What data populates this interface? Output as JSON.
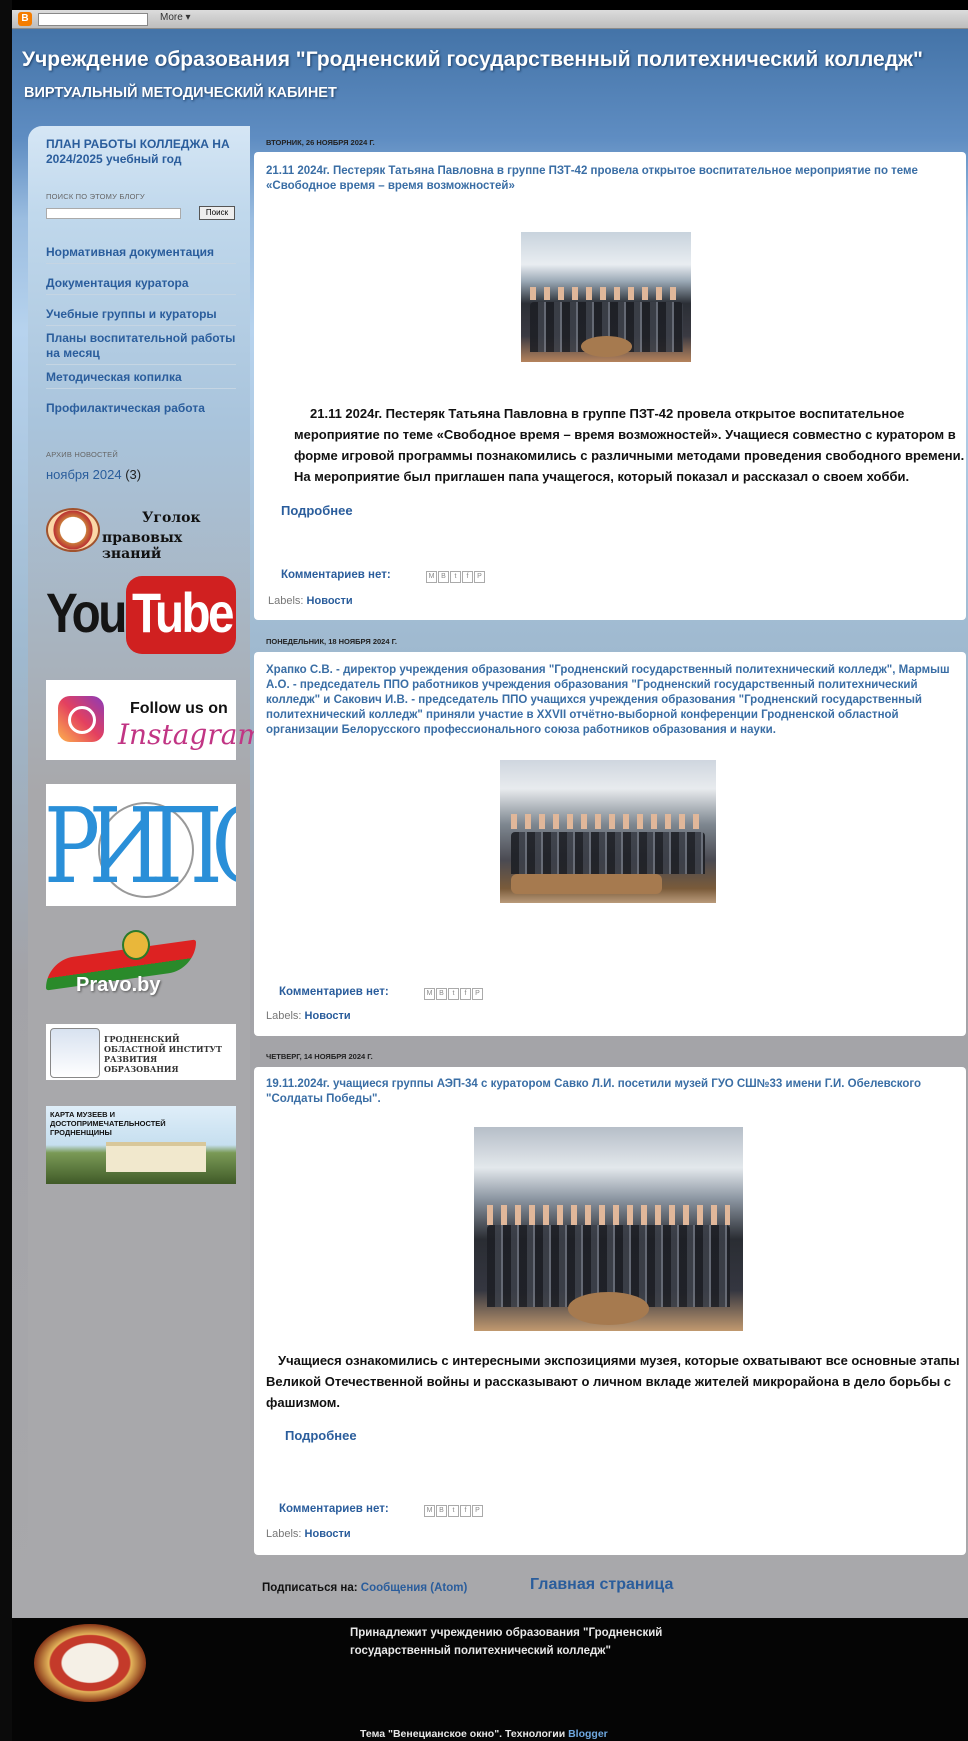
{
  "navbar": {
    "more_label": "More ▾",
    "logo": "B"
  },
  "header": {
    "title": "Учреждение образования \"Гродненский государственный политехнический колледж\"",
    "subtitle": "ВИРТУАЛЬНЫЙ МЕТОДИЧЕСКИЙ КАБИНЕТ"
  },
  "sidebar": {
    "plan_link": "ПЛАН РАБОТЫ КОЛЛЕДЖА НА 2024/2025 учебный год",
    "search_label": "ПОИСК ПО ЭТОМУ БЛОГУ",
    "search_button": "Поиск",
    "links": [
      "Нормативная документация",
      "Документация куратора",
      "Учебные группы и кураторы",
      "Планы воспитательной работы на месяц",
      "Методическая копилка",
      "Профилактическая работа"
    ],
    "archive_label": "АРХИВ НОВОСТЕЙ",
    "archive_month": "ноября 2024",
    "archive_count": "(3)",
    "ugolok_line1": "Уголок",
    "ugolok_line2": "правовых знаний",
    "youtube_you": "You",
    "youtube_tube": "Tube",
    "instagram_follow": "Follow us on",
    "instagram_name": "Instagram",
    "ripo_text": "РИПО",
    "pravo_text": "Pravo.by",
    "grodno_text": "ГРОДНЕНСКИЙ ОБЛАСТНОЙ ИНСТИТУТ РАЗВИТИЯ ОБРАЗОВАНИЯ",
    "karta_text": "КАРТА МУЗЕЕВ И ДОСТОПРИМЕЧАТЕЛЬНОСТЕЙ ГРОДНЕНЩИНЫ"
  },
  "posts": [
    {
      "date": "ВТОРНИК, 26 НОЯБРЯ 2024 Г.",
      "title": "21.11 2024г. Пестеряк Татьяна Павловна в группе ПЗТ-42 провела открытое воспитательное мероприятие по теме «Свободное время – время возможностей»",
      "body": "21.11 2024г. Пестеряк Татьяна Павловна в группе ПЗТ-42 провела открытое воспитательное мероприятие по теме «Свободное время – время возможностей». Учащиеся совместно с куратором в форме игровой программы познакомились с различными методами проведения свободного времени. На мероприятие был приглашен папа учащегося, который показал и рассказал о своем хобби.",
      "more": "Подробнее",
      "comments": "Комментариев нет:",
      "labels_prefix": "Labels:",
      "label": "Новости"
    },
    {
      "date": "ПОНЕДЕЛЬНИК, 18 НОЯБРЯ 2024 Г.",
      "title": "Храпко С.В. - директор учреждения образования \"Гродненский государственный политехнический колледж\", Мармыш А.О. - председатель ППО работников учреждения образования \"Гродненский государственный политехнический колледж\" и Сакович И.В. - председатель ППО учащихся учреждения образования \"Гродненский государственный политехнический колледж\" приняли участие в XXVII отчётно-выборной конференции Гродненской областной организации Белорусского профессионального союза работников образования и науки.",
      "comments": "Комментариев нет:",
      "labels_prefix": "Labels:",
      "label": "Новости"
    },
    {
      "date": "ЧЕТВЕРГ, 14 НОЯБРЯ 2024 Г.",
      "title": "19.11.2024г. учащиеся группы АЭП-34 с куратором Савко Л.И. посетили музей ГУО СШ№33 имени Г.И. Обелевского \"Солдаты Победы\".",
      "body": "Учащиеся ознакомились с интересными экспозициями музея, которые охватывают все основные этапы Великой Отечественной войны и рассказывают о личном вкладе жителей микрорайона в дело борьбы с фашизмом.",
      "more": "Подробнее",
      "comments": "Комментариев нет:",
      "labels_prefix": "Labels:",
      "label": "Новости"
    }
  ],
  "share_icons": [
    "M",
    "B",
    "t",
    "f",
    "P"
  ],
  "subscribe_label": "Подписаться на:",
  "subscribe_link": "Сообщения (Atom)",
  "home_link": "Главная страница",
  "footer": {
    "owner": "Принадлежит учреждению образования \"Гродненский государственный политехнический колледж\"",
    "theme_prefix": "Тема \"Венецианское окно\". Технологии",
    "theme_link": "Blogger"
  }
}
